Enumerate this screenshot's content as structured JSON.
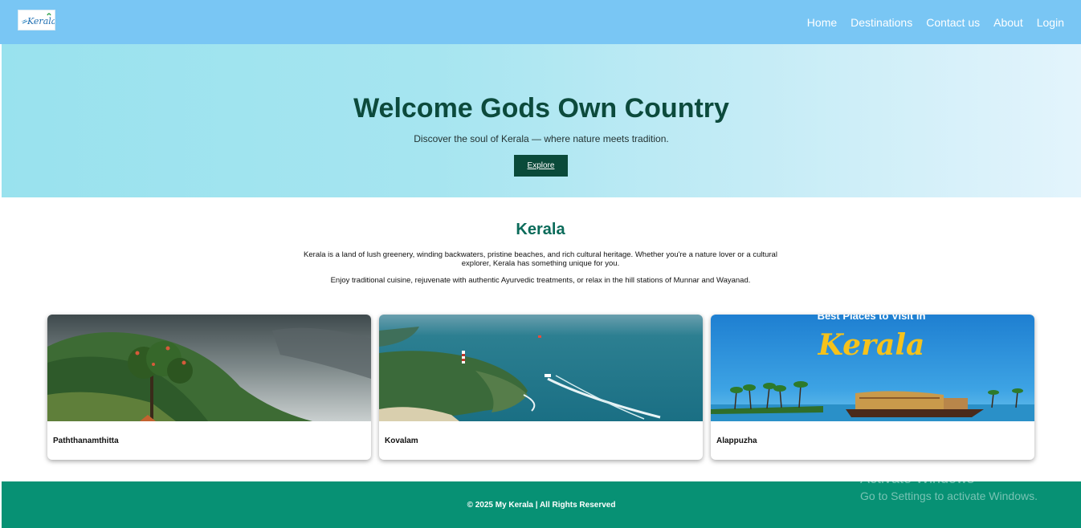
{
  "brand": {
    "logo_text": "Kerala"
  },
  "nav": {
    "items": [
      {
        "label": "Home"
      },
      {
        "label": "Destinations"
      },
      {
        "label": "Contact us"
      },
      {
        "label": "About"
      },
      {
        "label": "Login"
      }
    ]
  },
  "hero": {
    "title": "Welcome Gods Own Country",
    "subtitle": "Discover the soul of Kerala — where nature meets tradition.",
    "button_label": "Explore"
  },
  "about": {
    "title": "Kerala",
    "paragraph1": "Kerala is a land of lush greenery, winding backwaters, pristine beaches, and rich cultural heritage. Whether you're a nature lover or a cultural explorer, Kerala has something unique for you.",
    "paragraph2": "Enjoy traditional cuisine, rejuvenate with authentic Ayurvedic treatments, or relax in the hill stations of Munnar and Wayanad."
  },
  "cards": [
    {
      "label": "Paththanamthitta",
      "image": "misty-hills-with-tree"
    },
    {
      "label": "Kovalam",
      "image": "coastline-with-lighthouse-and-boat"
    },
    {
      "label": "Alappuzha",
      "image": "backwaters-houseboat-banner",
      "banner_text": "Best Places to Visit in",
      "banner_script": "Kerala"
    }
  ],
  "footer": {
    "text": "© 2025 My Kerala | All Rights Reserved"
  },
  "watermark": {
    "title": "Activate Windows",
    "subtitle": "Go to Settings to activate Windows."
  },
  "colors": {
    "navbar": "#79c6f4",
    "hero_title": "#0c4a3c",
    "button": "#0a4a3a",
    "section_title": "#0b6b5a",
    "footer": "#079174"
  }
}
